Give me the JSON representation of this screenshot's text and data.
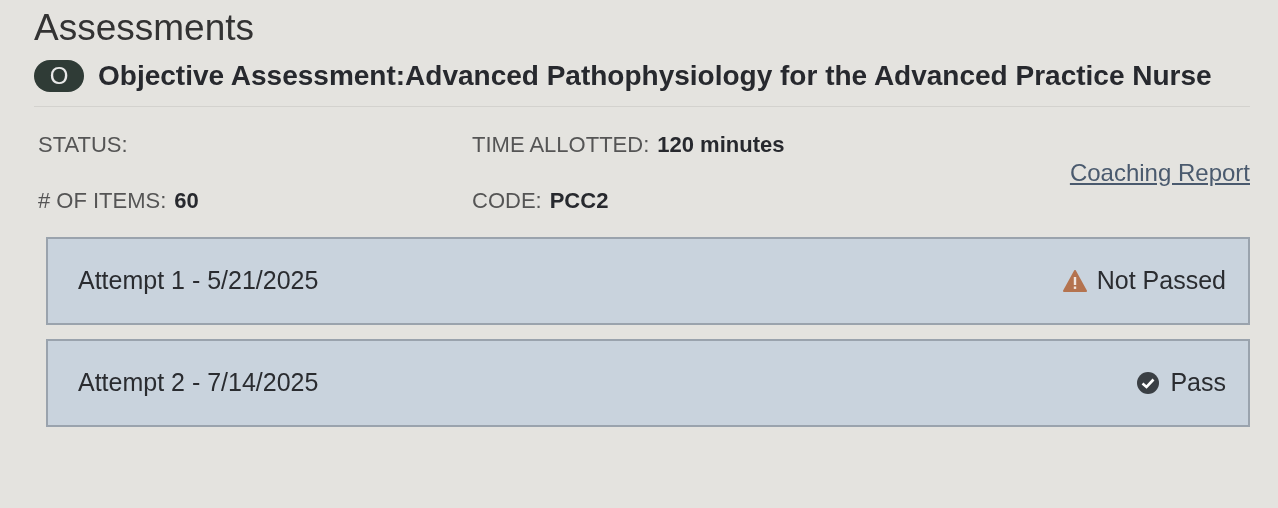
{
  "heading": "Assessments",
  "assessment": {
    "badge": "O",
    "title": "Objective Assessment:Advanced Pathophysiology for the Advanced Practice Nurse",
    "fields": [
      {
        "label": "STATUS:"
      },
      {
        "label": "TIME ALLOTTED:",
        "value": "120 minutes"
      },
      {
        "label": "# OF ITEMS:",
        "value": "60"
      },
      {
        "label": "CODE:",
        "value": "PCC2"
      }
    ],
    "link": "Coaching Report",
    "attempts": [
      {
        "label": "Attempt 1 - 5/21/2025",
        "result": "Not Passed",
        "kind": "not_passed"
      },
      {
        "label": "Attempt 2 - 7/14/2025",
        "result": "Pass",
        "kind": "pass"
      }
    ]
  }
}
